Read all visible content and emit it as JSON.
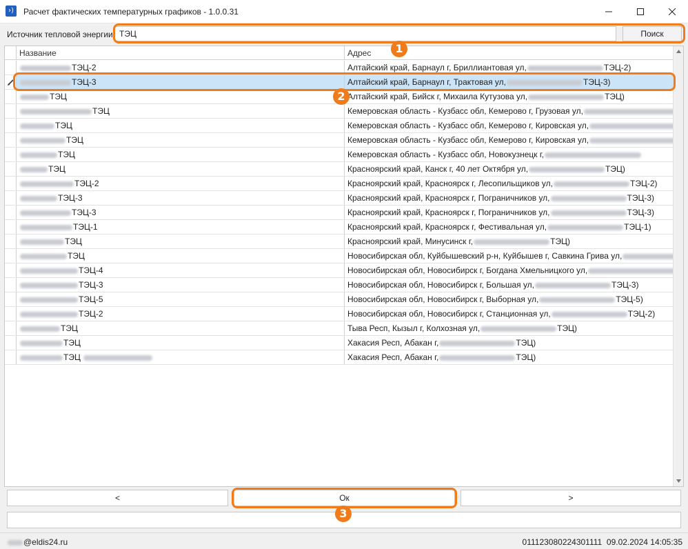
{
  "window": {
    "title": "Расчет фактических температурных графиков - 1.0.0.31",
    "app_icon_glyph": "›)",
    "controls": [
      "minimize-icon",
      "maximize-icon",
      "close-icon"
    ]
  },
  "search": {
    "label": "Источник тепловой энергии",
    "value": "ТЭЦ",
    "button_label": "Поиск"
  },
  "grid": {
    "columns": [
      "Название",
      "Адрес"
    ],
    "rows": [
      {
        "name": "ТЭЦ-2",
        "address": "Алтайский край, Барнаул г, Бриллиантовая ул,",
        "address_tail": "ТЭЦ-2)"
      },
      {
        "name": "ТЭЦ-3",
        "address": "Алтайский край, Барнаул г, Трактовая ул,",
        "address_tail": "ТЭЦ-3)"
      },
      {
        "name": "ТЭЦ",
        "address": "Алтайский край, Бийск г, Михаила Кутузова ул,",
        "address_tail": "ТЭЦ)"
      },
      {
        "name": "ТЭЦ",
        "address": "Кемеровская область - Кузбасс обл, Кемерово г, Грузовая ул,",
        "address_tail": ""
      },
      {
        "name": "ТЭЦ",
        "address": "Кемеровская область - Кузбасс обл, Кемерово г, Кировская ул,",
        "address_tail": ""
      },
      {
        "name": "ТЭЦ",
        "address": "Кемеровская область - Кузбасс обл, Кемерово г, Кировская ул,",
        "address_tail": ""
      },
      {
        "name": "ТЭЦ",
        "address": "Кемеровская область - Кузбасс обл, Новокузнецк г,",
        "address_tail": ""
      },
      {
        "name": "ТЭЦ",
        "address": "Красноярский край, Канск г, 40 лет Октября ул,",
        "address_tail": "ТЭЦ)"
      },
      {
        "name": "ТЭЦ-2",
        "address": "Красноярский край, Красноярск г, Лесопильщиков ул,",
        "address_tail": "ТЭЦ-2)"
      },
      {
        "name": "ТЭЦ-3",
        "address": "Красноярский край, Красноярск г, Пограничников ул,",
        "address_tail": "ТЭЦ-3)"
      },
      {
        "name": "ТЭЦ-3",
        "address": "Красноярский край, Красноярск г, Пограничников ул,",
        "address_tail": "ТЭЦ-3)"
      },
      {
        "name": "ТЭЦ-1",
        "address": "Красноярский край, Красноярск г, Фестивальная ул,",
        "address_tail": "ТЭЦ-1)"
      },
      {
        "name": "ТЭЦ",
        "address": "Красноярский край, Минусинск г,",
        "address_tail": "ТЭЦ)"
      },
      {
        "name": "ТЭЦ",
        "address": "Новосибирская обл, Куйбышевский р-н, Куйбышев г, Савкина Грива ул,",
        "address_tail": ""
      },
      {
        "name": "ТЭЦ-4",
        "address": "Новосибирская обл, Новосибирск г, Богдана Хмельницкого ул,",
        "address_tail": ""
      },
      {
        "name": "ТЭЦ-3",
        "address": "Новосибирская обл, Новосибирск г, Большая ул,",
        "address_tail": "ТЭЦ-3)"
      },
      {
        "name": "ТЭЦ-5",
        "address": "Новосибирская обл, Новосибирск г, Выборная ул,",
        "address_tail": "ТЭЦ-5)"
      },
      {
        "name": "ТЭЦ-2",
        "address": "Новосибирская обл, Новосибирск г, Станционная ул,",
        "address_tail": "ТЭЦ-2)"
      },
      {
        "name": "ТЭЦ",
        "address": "Тыва Респ, Кызыл г, Колхозная ул,",
        "address_tail": "ТЭЦ)"
      },
      {
        "name": "ТЭЦ",
        "address": "Хакасия Респ, Абакан г,",
        "address_tail": "ТЭЦ)"
      },
      {
        "name": "ТЭЦ",
        "address": "Хакасия Респ, Абакан г,",
        "address_tail": "ТЭЦ)"
      }
    ],
    "selected_index": 1
  },
  "nav": {
    "prev_label": "<",
    "ok_label": "Ок",
    "next_label": ">"
  },
  "status": {
    "user": "@eldis24.ru",
    "code": "011123080224301111",
    "datetime": "09.02.2024 14:05:35"
  },
  "annotations": {
    "badge1": "1",
    "badge2": "2",
    "badge3": "3",
    "accent_color": "#f07b1a"
  }
}
